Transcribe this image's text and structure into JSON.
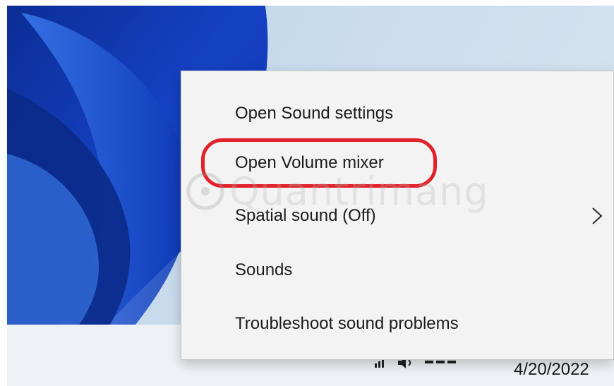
{
  "context_menu": {
    "items": [
      {
        "label": "Open Sound settings"
      },
      {
        "label": "Open Volume mixer",
        "highlighted": true
      },
      {
        "label": "Spatial sound (Off)",
        "has_submenu": true
      },
      {
        "label": "Sounds"
      },
      {
        "label": "Troubleshoot sound problems"
      }
    ],
    "highlight_color": "#e2222a"
  },
  "taskbar": {
    "date": "4/20/2022",
    "icons": [
      "network-icon",
      "volume-icon",
      "language-indicator"
    ]
  },
  "watermark": {
    "text": "Quantrimang"
  },
  "icons": {
    "submenu": "chevron-right-icon"
  }
}
